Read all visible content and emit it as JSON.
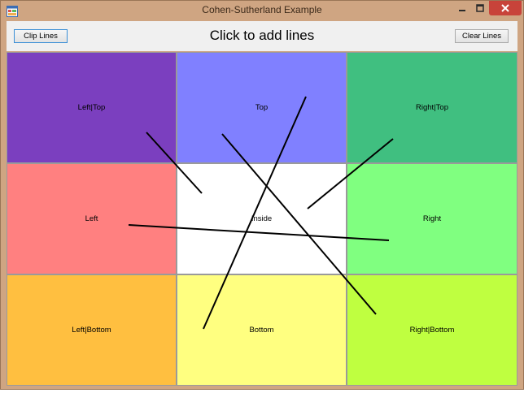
{
  "window": {
    "title": "Cohen-Sutherland Example"
  },
  "toolbar": {
    "clip_label": "Clip Lines",
    "heading": "Click to add lines",
    "clear_label": "Clear Lines"
  },
  "regions": {
    "left_top": {
      "label": "Left|Top",
      "color": "#7b3fbf"
    },
    "top": {
      "label": "Top",
      "color": "#8080ff"
    },
    "right_top": {
      "label": "Right|Top",
      "color": "#40bf80"
    },
    "left": {
      "label": "Left",
      "color": "#ff8080"
    },
    "inside": {
      "label": "Inside",
      "color": "#ffffff"
    },
    "right": {
      "label": "Right",
      "color": "#80ff80"
    },
    "left_bottom": {
      "label": "Left|Bottom",
      "color": "#ffbf40"
    },
    "bottom": {
      "label": "Bottom",
      "color": "#ffff80"
    },
    "right_bottom": {
      "label": "Right|Bottom",
      "color": "#bfff40"
    }
  },
  "icons": {
    "app": "app-icon",
    "minimize": "minimize-icon",
    "maximize": "maximize-icon",
    "close": "close-icon"
  }
}
